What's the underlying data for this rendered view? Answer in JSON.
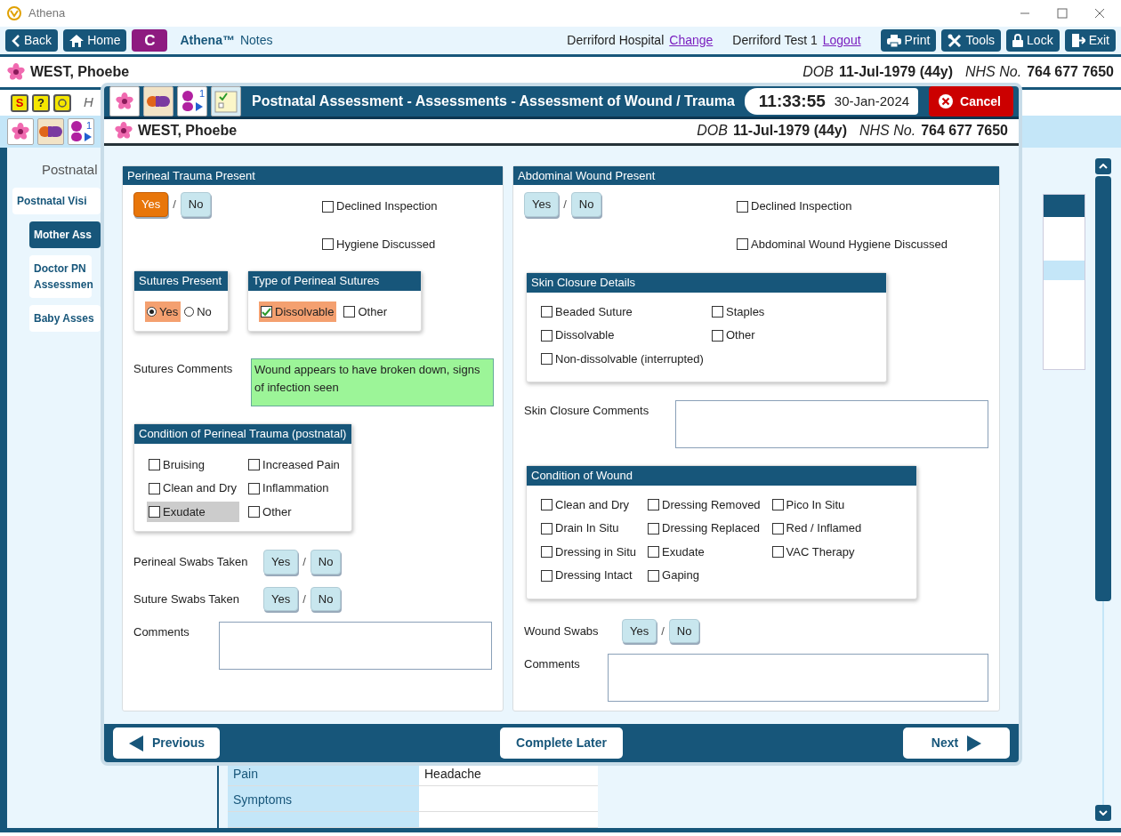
{
  "window": {
    "title": "Athena"
  },
  "toolbar": {
    "left_buttons": [
      {
        "label": "Back",
        "kind": "back"
      },
      {
        "label": "Home",
        "kind": "home"
      },
      {
        "label": "C",
        "kind": "brand"
      }
    ],
    "app_name": "Athena™",
    "app_suffix": "Notes",
    "hospital": "Derriford Hospital",
    "change_link": "Change",
    "user": "Derriford Test 1",
    "logout_link": "Logout",
    "right_buttons": [
      {
        "label": "Print",
        "kind": "print"
      },
      {
        "label": "Tools",
        "kind": "tools"
      },
      {
        "label": "Lock",
        "kind": "lock"
      },
      {
        "label": "Exit",
        "kind": "exit"
      }
    ]
  },
  "patient": {
    "name": "WEST, Phoebe",
    "dob_label": "DOB",
    "dob": "11-Jul-1979 (44y)",
    "nhs_label": "NHS No.",
    "nhs": "764 677 7650"
  },
  "status_icons": [
    {
      "kind": "alert",
      "glyph": "S"
    },
    {
      "kind": "help",
      "glyph": "?"
    },
    {
      "kind": "sun"
    }
  ],
  "hint": "H",
  "record_icons": [
    {
      "kind": "flower"
    },
    {
      "kind": "pill"
    },
    {
      "kind": "baby",
      "badge": "1"
    }
  ],
  "nav": {
    "title": "Postnatal",
    "items": [
      {
        "label": "Postnatal Visi",
        "selected": false,
        "children": [
          {
            "label": "Mother Ass",
            "selected": true
          },
          {
            "label": "Doctor PN Assessmen",
            "selected": false
          },
          {
            "label": "Baby Asses",
            "selected": false
          }
        ]
      }
    ]
  },
  "table": {
    "rows": [
      {
        "label": "Pain",
        "value": "Headache"
      },
      {
        "label": "Symptoms"
      }
    ]
  },
  "modal": {
    "icons": [
      {
        "kind": "flower"
      },
      {
        "kind": "pill"
      },
      {
        "kind": "baby",
        "badge": "1"
      },
      {
        "kind": "notes"
      }
    ],
    "title": "Postnatal Assessment - Assessments - Assessment of Wound / Trauma",
    "time": "11:33:55",
    "date": "30-Jan-2024",
    "cancel": "Cancel",
    "patient": {
      "name": "WEST, Phoebe",
      "dob_label": "DOB",
      "dob": "11-Jul-1979 (44y)",
      "nhs_label": "NHS No.",
      "nhs": "764 677 7650"
    },
    "left": {
      "title": "Perineal Trauma Present",
      "present": {
        "options": [
          {
            "label": "Yes",
            "selected": true
          },
          {
            "label": "No",
            "selected": false
          }
        ],
        "separator": "/"
      },
      "flags": [
        {
          "label": "Declined Inspection",
          "checked": false
        },
        {
          "label": "Hygiene Discussed",
          "checked": false
        }
      ],
      "sutures_present": {
        "title": "Sutures Present",
        "options": [
          {
            "label": "Yes",
            "selected": true
          },
          {
            "label": "No",
            "selected": false
          }
        ]
      },
      "suture_types": {
        "title": "Type of Perineal Sutures",
        "items": [
          {
            "label": "Dissolvable",
            "checked": true
          },
          {
            "label": "Other",
            "checked": false
          }
        ]
      },
      "sutures_comments": {
        "label": "Sutures Comments",
        "value": "Wound appears to have broken down, signs of infection seen"
      },
      "condition": {
        "title": "Condition of Perineal Trauma (postnatal)",
        "items": [
          {
            "label": "Bruising",
            "checked": false,
            "highlighted": false
          },
          {
            "label": "Increased Pain",
            "checked": false,
            "highlighted": false
          },
          {
            "label": "Clean and Dry",
            "checked": false,
            "highlighted": false
          },
          {
            "label": "Inflammation",
            "checked": false,
            "highlighted": false
          },
          {
            "label": "Exudate",
            "checked": false,
            "highlighted": true
          },
          {
            "label": "Other",
            "checked": false,
            "highlighted": false
          }
        ]
      },
      "swabs": [
        {
          "label": "Perineal Swabs Taken",
          "options": [
            {
              "label": "Yes",
              "selected": false
            },
            {
              "label": "No",
              "selected": false
            }
          ],
          "separator": "/"
        },
        {
          "label": "Suture Swabs Taken",
          "options": [
            {
              "label": "Yes",
              "selected": false
            },
            {
              "label": "No",
              "selected": false
            }
          ],
          "separator": "/"
        }
      ],
      "comments": {
        "label": "Comments"
      }
    },
    "right": {
      "title": "Abdominal Wound Present",
      "present": {
        "options": [
          {
            "label": "Yes",
            "selected": false
          },
          {
            "label": "No",
            "selected": false
          }
        ],
        "separator": "/"
      },
      "flags": [
        {
          "label": "Declined Inspection",
          "checked": false
        },
        {
          "label": "Abdominal Wound Hygiene Discussed",
          "checked": false
        }
      ],
      "skin_closure": {
        "title": "Skin Closure Details",
        "items": [
          {
            "label": "Beaded Suture",
            "checked": false
          },
          {
            "label": "Staples",
            "checked": false
          },
          {
            "label": "Dissolvable",
            "checked": false
          },
          {
            "label": "Other",
            "checked": false
          },
          {
            "label": "Non-dissolvable (interrupted)",
            "checked": false
          }
        ]
      },
      "skin_comments": {
        "label": "Skin Closure Comments"
      },
      "condition": {
        "title": "Condition of Wound",
        "items": [
          {
            "label": "Clean and Dry",
            "checked": false
          },
          {
            "label": "Dressing Removed",
            "checked": false
          },
          {
            "label": "Pico In Situ",
            "checked": false
          },
          {
            "label": "Drain In Situ",
            "checked": false
          },
          {
            "label": "Dressing Replaced",
            "checked": false
          },
          {
            "label": "Red / Inflamed",
            "checked": false
          },
          {
            "label": "Dressing in Situ",
            "checked": false
          },
          {
            "label": "Exudate",
            "checked": false
          },
          {
            "label": "VAC Therapy",
            "checked": false
          },
          {
            "label": "Dressing Intact",
            "checked": false
          },
          {
            "label": "Gaping",
            "checked": false
          }
        ]
      },
      "swabs": {
        "label": "Wound Swabs",
        "options": [
          {
            "label": "Yes",
            "selected": false
          },
          {
            "label": "No",
            "selected": false
          }
        ],
        "separator": "/"
      },
      "comments": {
        "label": "Comments"
      }
    },
    "footer": {
      "previous": "Previous",
      "complete_later": "Complete Later",
      "next": "Next"
    }
  }
}
